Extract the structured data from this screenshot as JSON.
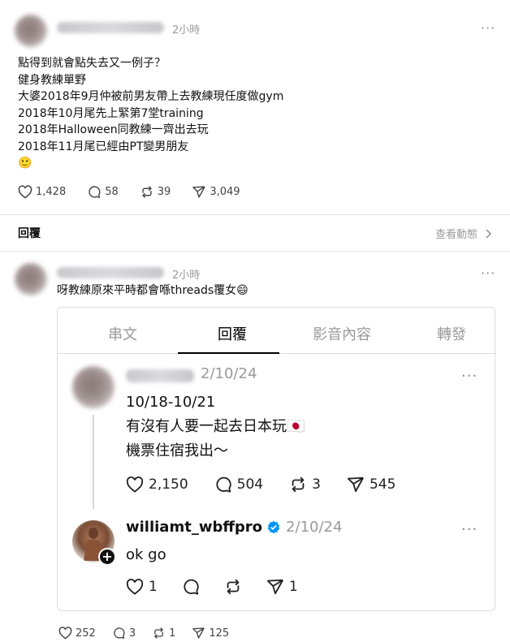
{
  "post1": {
    "time": "2小時",
    "more": "···",
    "lines": [
      "點得到就會點失去又一例子？",
      "健身教練單野",
      "大婆2018年9月仲被前男友帶上去教練現任度做gym",
      "2018年10月尾先上緊第7堂training",
      "2018年Halloween同教練一齊出去玩",
      "2018年11月尾已經由PT變男朋友",
      "🙂"
    ],
    "likes": "1,428",
    "comments": "58",
    "reposts": "39",
    "shares": "3,049"
  },
  "reply_bar": {
    "label": "回覆",
    "activity": "查看動態",
    "chevron": ">"
  },
  "post2": {
    "time": "2小時",
    "more": "···",
    "text": "呀教練原來平時都會喺threads覆女😄",
    "likes": "252",
    "comments": "3",
    "reposts": "1",
    "shares": "125"
  },
  "embed": {
    "tabs": [
      "串文",
      "回覆",
      "影音內容",
      "轉發"
    ],
    "active_tab": 1,
    "thread": {
      "time": "2/10/24",
      "more": "···",
      "lines": [
        "10/18-10/21",
        "有沒有人要一起去日本玩🇯🇵",
        "機票住宿我出～"
      ],
      "likes": "2,150",
      "comments": "504",
      "reposts": "3",
      "shares": "545"
    },
    "reply": {
      "username": "williamt_wbffpro",
      "time": "2/10/24",
      "more": "···",
      "text": "ok go",
      "likes": "1",
      "shares": "1"
    }
  },
  "colors": {
    "verified": "#0095f6",
    "divider": "#e5e5e5",
    "muted": "#999999"
  },
  "icons": [
    "heart-icon",
    "comment-icon",
    "repost-icon",
    "share-icon",
    "verified-badge-icon",
    "follow-plus-icon",
    "more-icon",
    "chevron-right-icon"
  ]
}
